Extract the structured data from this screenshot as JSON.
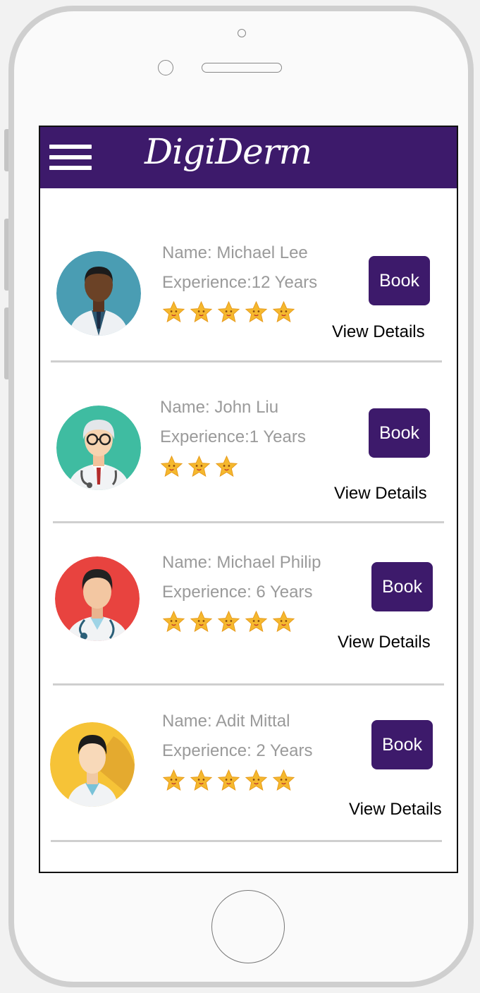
{
  "app": {
    "title": "DigiDerm"
  },
  "doctors": [
    {
      "name": "Name: Michael Lee",
      "experience": "Experience:12 Years",
      "rating": 5,
      "book_label": "Book",
      "details_label": "View Details",
      "avatar": "doctor-dark-skin-avatar",
      "avatar_bg": "#4a9db3"
    },
    {
      "name": "Name: John Liu",
      "experience": "Experience:1 Years",
      "rating": 3,
      "book_label": "Book",
      "details_label": "View Details",
      "avatar": "senior-doctor-avatar",
      "avatar_bg": "#3fbca1"
    },
    {
      "name": "Name: Michael Philip",
      "experience": "Experience: 6 Years",
      "rating": 5,
      "book_label": "Book",
      "details_label": "View Details",
      "avatar": "doctor-stethoscope-avatar",
      "avatar_bg": "#e8433f"
    },
    {
      "name": "Name: Adit Mittal",
      "experience": "Experience:  2 Years",
      "rating": 5,
      "book_label": "Book",
      "details_label": "View Details",
      "avatar": "young-doctor-avatar",
      "avatar_bg": "#f6c337"
    }
  ],
  "colors": {
    "brand": "#3d1a6b",
    "star": "#f5b82e",
    "text_muted": "#9a9a9a"
  },
  "icons": {
    "menu": "hamburger-menu-icon",
    "rating": "star-icon"
  }
}
